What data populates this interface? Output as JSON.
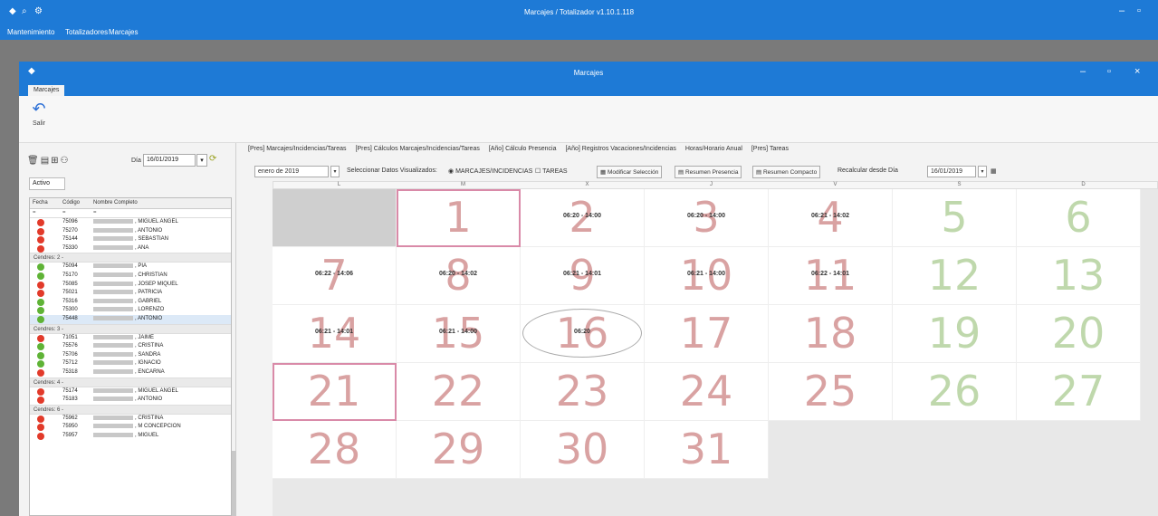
{
  "app": {
    "title": "Marcajes / Totalizador v1.10.1.118",
    "menu": [
      "Mantenimiento",
      "Totalizadores",
      "Marcajes"
    ]
  },
  "window": {
    "title": "Marcajes",
    "tab": "Marcajes",
    "exit_label": "Salir"
  },
  "left": {
    "date_label": "Día",
    "date_value": "16/01/2019",
    "filter_value": "Activo",
    "columns": [
      "Fecha",
      "Código",
      "Nombre Completo"
    ],
    "filter_row": [
      "=",
      "=",
      "="
    ],
    "rows": [
      {
        "type": "emp",
        "status": "red",
        "code": "75096",
        "name": ", MIGUEL ANGEL"
      },
      {
        "type": "emp",
        "status": "red",
        "code": "75270",
        "name": ", ANTONIO"
      },
      {
        "type": "emp",
        "status": "red",
        "code": "75144",
        "name": ", SEBASTIAN"
      },
      {
        "type": "emp",
        "status": "red",
        "code": "75330",
        "name": ", ANA"
      },
      {
        "type": "group",
        "label": "Cendres: 2 -"
      },
      {
        "type": "emp",
        "status": "green",
        "code": "75094",
        "name": ", PIA"
      },
      {
        "type": "emp",
        "status": "green",
        "code": "75170",
        "name": ", CHRISTIAN"
      },
      {
        "type": "emp",
        "status": "red",
        "code": "75085",
        "name": ", JOSEP MIQUEL"
      },
      {
        "type": "emp",
        "status": "red",
        "code": "75021",
        "name": ", PATRICIA"
      },
      {
        "type": "emp",
        "status": "green",
        "code": "75316",
        "name": ", GABRIEL"
      },
      {
        "type": "emp",
        "status": "green",
        "code": "75300",
        "name": ", LORENZO"
      },
      {
        "type": "emp",
        "status": "green",
        "code": "75448",
        "name": ", ANTONIO",
        "selected": true
      },
      {
        "type": "group",
        "label": "Cendres: 3 -"
      },
      {
        "type": "emp",
        "status": "red",
        "code": "71051",
        "name": ", JAIME"
      },
      {
        "type": "emp",
        "status": "green",
        "code": "75576",
        "name": ", CRISTINA"
      },
      {
        "type": "emp",
        "status": "green",
        "code": "75706",
        "name": ", SANDRA"
      },
      {
        "type": "emp",
        "status": "green",
        "code": "75712",
        "name": ", IGNACIO"
      },
      {
        "type": "emp",
        "status": "red",
        "code": "75318",
        "name": ", ENCARNA"
      },
      {
        "type": "group",
        "label": "Cendres: 4 -"
      },
      {
        "type": "emp",
        "status": "red",
        "code": "75174",
        "name": ", MIGUEL ANGEL"
      },
      {
        "type": "emp",
        "status": "red",
        "code": "75183",
        "name": ", ANTONIO"
      },
      {
        "type": "group",
        "label": "Cendres: 6 -"
      },
      {
        "type": "emp",
        "status": "red",
        "code": "75962",
        "name": ", CRISTINA"
      },
      {
        "type": "emp",
        "status": "red",
        "code": "75950",
        "name": ", M CONCEPCION"
      },
      {
        "type": "emp",
        "status": "red",
        "code": "75957",
        "name": ", MIGUEL"
      }
    ]
  },
  "right": {
    "links": [
      "[Pres] Marcajes/Incidencias/Tareas",
      "[Pres] Cálculos Marcajes/Incidencias/Tareas",
      "[Año] Cálculo Presencia",
      "[Año] Registros Vacaciones/Incidencias",
      "Horas/Horario Anual",
      "[Pres] Tareas"
    ],
    "toolbar": {
      "month": "enero de 2019",
      "select_label": "Seleccionar Datos Visualizados:",
      "radio_label": "MARCAJES/INCIDENCIAS",
      "check_label": "TAREAS",
      "btn_modify": "Modificar Selección",
      "btn_summary": "Resumen Presencia",
      "btn_compact": "Resumen Compacto",
      "since_label": "Recalcular desde Día",
      "since_value": "16/01/2019"
    },
    "weekdays": [
      "L",
      "M",
      "X",
      "J",
      "V",
      "S",
      "D"
    ],
    "days": [
      {
        "n": "",
        "empty": true
      },
      {
        "n": "1",
        "ev": "",
        "today": true
      },
      {
        "n": "2",
        "ev": "06:20 - 14:00"
      },
      {
        "n": "3",
        "ev": "06:20 - 14:00"
      },
      {
        "n": "4",
        "ev": "06:21 - 14:02"
      },
      {
        "n": "5",
        "ev": "",
        "weekend": true
      },
      {
        "n": "6",
        "ev": "",
        "weekend": true
      },
      {
        "n": "7",
        "ev": "06:22 - 14:06"
      },
      {
        "n": "8",
        "ev": "06:20 - 14:02"
      },
      {
        "n": "9",
        "ev": "06:21 - 14:01"
      },
      {
        "n": "10",
        "ev": "06:21 - 14:00"
      },
      {
        "n": "11",
        "ev": "06:22 - 14:01"
      },
      {
        "n": "12",
        "ev": "",
        "weekend": true
      },
      {
        "n": "13",
        "ev": "",
        "weekend": true
      },
      {
        "n": "14",
        "ev": "06:21 - 14:01"
      },
      {
        "n": "15",
        "ev": "06:21 - 14:00"
      },
      {
        "n": "16",
        "ev": "06:20",
        "circled": true
      },
      {
        "n": "17",
        "ev": ""
      },
      {
        "n": "18",
        "ev": ""
      },
      {
        "n": "19",
        "ev": "",
        "weekend": true
      },
      {
        "n": "20",
        "ev": "",
        "weekend": true
      },
      {
        "n": "21",
        "ev": "",
        "today": true
      },
      {
        "n": "22",
        "ev": ""
      },
      {
        "n": "23",
        "ev": ""
      },
      {
        "n": "24",
        "ev": ""
      },
      {
        "n": "25",
        "ev": ""
      },
      {
        "n": "26",
        "ev": "",
        "weekend": true
      },
      {
        "n": "27",
        "ev": "",
        "weekend": true
      },
      {
        "n": "28",
        "ev": ""
      },
      {
        "n": "29",
        "ev": ""
      },
      {
        "n": "30",
        "ev": ""
      },
      {
        "n": "31",
        "ev": ""
      }
    ]
  },
  "colors": {
    "accent": "#1e7ad6",
    "day_number": "#d9a2a2",
    "weekend_number": "#bfd8ac",
    "status_red": "#e23a2a",
    "status_green": "#5fb336"
  }
}
